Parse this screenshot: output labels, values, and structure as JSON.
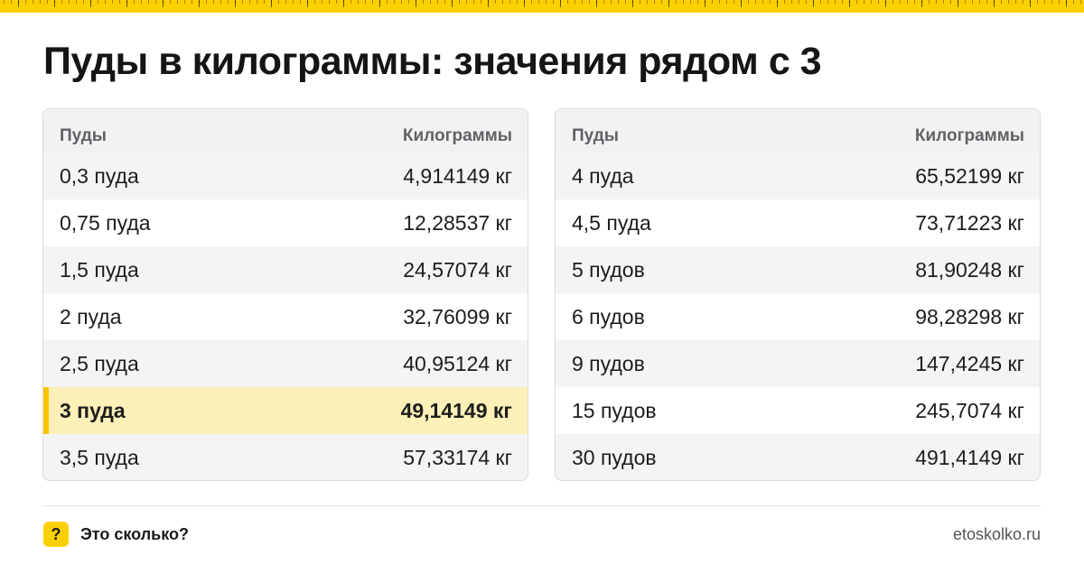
{
  "title": "Пуды в килограммы: значения рядом с 3",
  "colors": {
    "accent": "#fbd000",
    "highlight_row": "#fdf0b8",
    "header_bg": "#f2f2f2"
  },
  "tables": [
    {
      "headers": [
        "Пуды",
        "Килограммы"
      ],
      "rows": [
        {
          "pud": "0,3 пуда",
          "kg": "4,914149 кг",
          "highlighted": false
        },
        {
          "pud": "0,75 пуда",
          "kg": "12,28537 кг",
          "highlighted": false
        },
        {
          "pud": "1,5 пуда",
          "kg": "24,57074 кг",
          "highlighted": false
        },
        {
          "pud": "2 пуда",
          "kg": "32,76099 кг",
          "highlighted": false
        },
        {
          "pud": "2,5 пуда",
          "kg": "40,95124 кг",
          "highlighted": false
        },
        {
          "pud": "3 пуда",
          "kg": "49,14149 кг",
          "highlighted": true
        },
        {
          "pud": "3,5 пуда",
          "kg": "57,33174 кг",
          "highlighted": false
        }
      ]
    },
    {
      "headers": [
        "Пуды",
        "Килограммы"
      ],
      "rows": [
        {
          "pud": "4 пуда",
          "kg": "65,52199 кг",
          "highlighted": false
        },
        {
          "pud": "4,5 пуда",
          "kg": "73,71223 кг",
          "highlighted": false
        },
        {
          "pud": "5 пудов",
          "kg": "81,90248 кг",
          "highlighted": false
        },
        {
          "pud": "6 пудов",
          "kg": "98,28298 кг",
          "highlighted": false
        },
        {
          "pud": "9 пудов",
          "kg": "147,4245 кг",
          "highlighted": false
        },
        {
          "pud": "15 пудов",
          "kg": "245,7074 кг",
          "highlighted": false
        },
        {
          "pud": "30 пудов",
          "kg": "491,4149 кг",
          "highlighted": false
        }
      ]
    }
  ],
  "footer": {
    "badge": "?",
    "badge_icon": "question-mark-icon",
    "brand": "Это сколько?",
    "site": "etoskolko.ru"
  }
}
